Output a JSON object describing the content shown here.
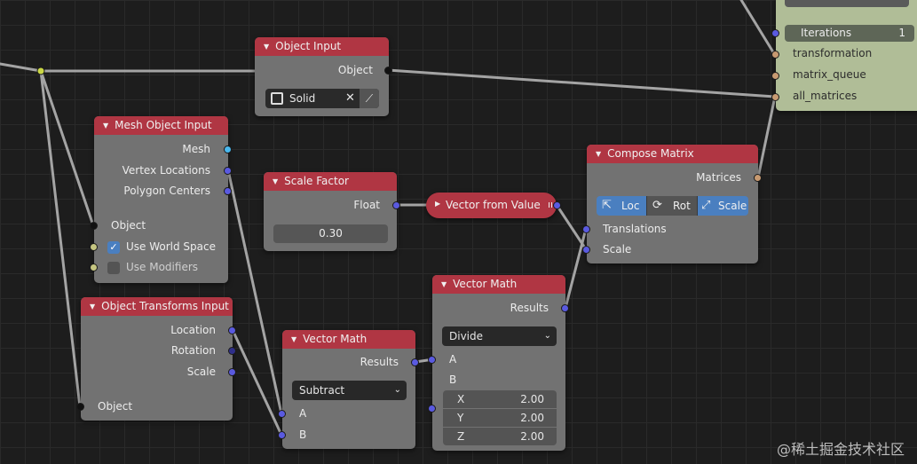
{
  "nodes": {
    "object_input": {
      "title": "Object Input",
      "output": "Object",
      "field_value": "Solid"
    },
    "mesh_object_input": {
      "title": "Mesh Object Input",
      "outputs": [
        "Mesh",
        "Vertex Locations",
        "Polygon Centers"
      ],
      "input": "Object",
      "checkboxes": [
        {
          "label": "Use World Space",
          "checked": true
        },
        {
          "label": "Use Modifiers",
          "checked": false
        }
      ]
    },
    "scale_factor": {
      "title": "Scale Factor",
      "output": "Float",
      "value": "0.30"
    },
    "vector_from_value": {
      "title": "Vector from Value"
    },
    "compose_matrix": {
      "title": "Compose Matrix",
      "output": "Matrices",
      "modes": [
        "Loc",
        "Rot",
        "Scale"
      ],
      "inputs": [
        "Translations",
        "Scale"
      ]
    },
    "object_transforms_input": {
      "title": "Object Transforms Input",
      "outputs": [
        "Location",
        "Rotation",
        "Scale"
      ],
      "input": "Object"
    },
    "vector_math_1": {
      "title": "Vector Math",
      "output": "Results",
      "operation": "Subtract",
      "inputs": [
        "A",
        "B"
      ]
    },
    "vector_math_2": {
      "title": "Vector Math",
      "output": "Results",
      "operation": "Divide",
      "inputs": [
        "A",
        "B"
      ],
      "vector": [
        {
          "label": "X",
          "value": "2.00"
        },
        {
          "label": "Y",
          "value": "2.00"
        },
        {
          "label": "Z",
          "value": "2.00"
        }
      ]
    },
    "loop": {
      "iterations_label": "Iterations",
      "iterations_value": "1",
      "inputs": [
        "transformation",
        "matrix_queue",
        "all_matrices"
      ]
    }
  },
  "watermark": "@稀土掘金技术社区",
  "colors": {
    "header": "#b03643",
    "node_body": "#727272",
    "socket_vector": "#5a5ae0",
    "socket_mesh": "#4ab8ee",
    "socket_bool": "#c5c581",
    "socket_matrix": "#c89a71",
    "loop_node": "#b0bd97",
    "accent": "#4a7fc0"
  }
}
